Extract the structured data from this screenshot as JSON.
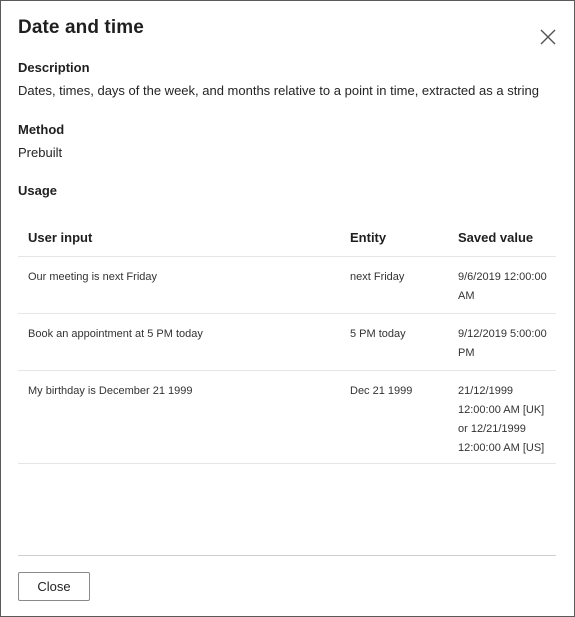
{
  "dialog": {
    "title": "Date and time",
    "close_icon": "close-icon"
  },
  "description": {
    "label": "Description",
    "value": "Dates, times, days of the week, and months relative to a point in time, extracted as a string"
  },
  "method": {
    "label": "Method",
    "value": "Prebuilt"
  },
  "usage": {
    "label": "Usage",
    "table": {
      "headers": [
        "User input",
        "Entity",
        "Saved value"
      ],
      "rows": [
        {
          "user_input": "Our meeting is next Friday",
          "entity": "next Friday",
          "saved_value_lines": [
            "9/6/2019 12:00:00",
            "AM"
          ]
        },
        {
          "user_input": "Book an appointment at 5 PM today",
          "entity": "5 PM today",
          "saved_value_lines": [
            "9/12/2019 5:00:00",
            "PM"
          ]
        },
        {
          "user_input": "My birthday is December 21 1999",
          "entity": "Dec 21 1999",
          "saved_value_lines": [
            "21/12/1999",
            "12:00:00 AM [UK]",
            "or 12/21/1999",
            "12:00:00 AM [US]"
          ]
        }
      ]
    }
  },
  "footer": {
    "close_label": "Close"
  },
  "colors": {
    "border": "#5a5a5a",
    "text": "#242424",
    "divider": "#e6e6e6"
  }
}
